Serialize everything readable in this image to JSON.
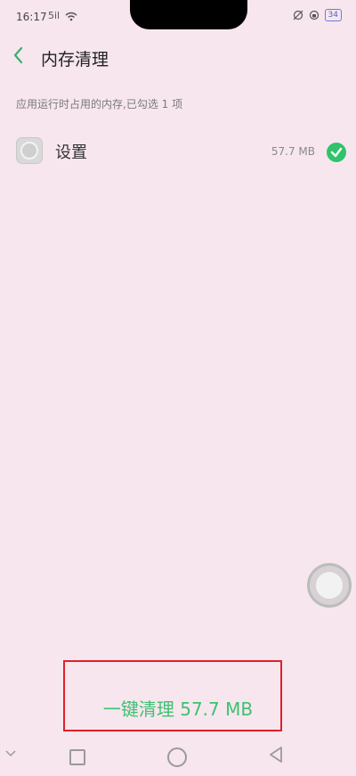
{
  "status_bar": {
    "time": "16:17",
    "signal": "5il",
    "battery": "34"
  },
  "header": {
    "title": "内存清理",
    "back_icon": "chevron-left-icon"
  },
  "subtitle": "应用运行时占用的内存,已勾选 1 项",
  "apps": [
    {
      "name": "设置",
      "size": "57.7 MB",
      "checked": true
    }
  ],
  "clean_button": {
    "label": "一键清理 57.7 MB"
  },
  "colors": {
    "accent": "#3ec172",
    "check": "#2fc36a",
    "highlight": "#e0202a",
    "background": "#f7e6ee"
  }
}
